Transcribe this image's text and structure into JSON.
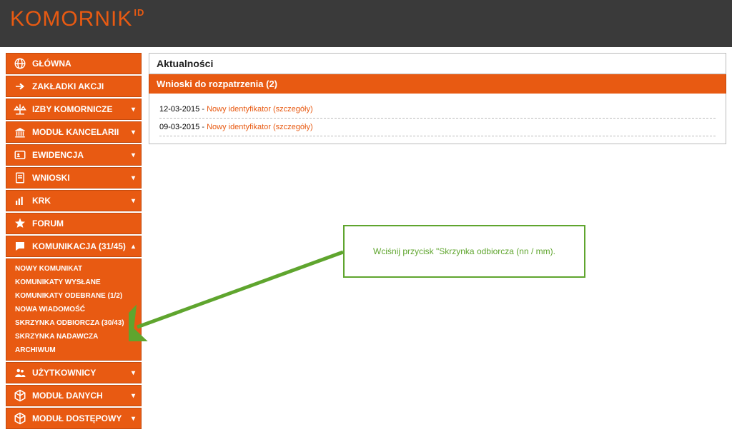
{
  "logo": {
    "text": "KOMORNIK",
    "suffix": "ID"
  },
  "sidebar": {
    "items": [
      {
        "label": "GŁÓWNA",
        "icon": "globe-icon",
        "expandable": false
      },
      {
        "label": "ZAKŁADKI AKCJI",
        "icon": "arrow-right-icon",
        "expandable": false
      },
      {
        "label": "IZBY KOMORNICZE",
        "icon": "scales-icon",
        "expandable": true
      },
      {
        "label": "MODUŁ KANCELARII",
        "icon": "institution-icon",
        "expandable": true
      },
      {
        "label": "EWIDENCJA",
        "icon": "person-card-icon",
        "expandable": true
      },
      {
        "label": "WNIOSKI",
        "icon": "document-icon",
        "expandable": true
      },
      {
        "label": "KRK",
        "icon": "bars-icon",
        "expandable": true
      },
      {
        "label": "FORUM",
        "icon": "star-icon",
        "expandable": false
      },
      {
        "label": "KOMUNIKACJA (31/45)",
        "icon": "speech-icon",
        "expandable": true,
        "expanded": true
      }
    ],
    "komunikacja_sub": [
      "NOWY KOMUNIKAT",
      "KOMUNIKATY WYSŁANE",
      "KOMUNIKATY ODEBRANE (1/2)",
      "NOWA WIADOMOŚĆ",
      "SKRZYNKA ODBIORCZA (30/43)",
      "SKRZYNKA NADAWCZA",
      "ARCHIWUM"
    ],
    "items_after": [
      {
        "label": "UŻYTKOWNICY",
        "icon": "users-icon",
        "expandable": true
      },
      {
        "label": "MODUŁ DANYCH",
        "icon": "cube-icon",
        "expandable": true
      },
      {
        "label": "MODUŁ DOSTĘPOWY",
        "icon": "cube-icon",
        "expandable": true
      }
    ]
  },
  "main": {
    "news_title": "Aktualności",
    "requests_header": "Wnioski do rozpatrzenia (2)",
    "requests": [
      {
        "date": "12-03-2015",
        "sep": " - ",
        "label": "Nowy identyfikator (szczegóły)"
      },
      {
        "date": "09-03-2015",
        "sep": " - ",
        "label": "Nowy identyfikator (szczegóły)"
      }
    ]
  },
  "callout": {
    "text": "Wciśnij przycisk \"Skrzynka odbiorcza (nn / mm)."
  }
}
